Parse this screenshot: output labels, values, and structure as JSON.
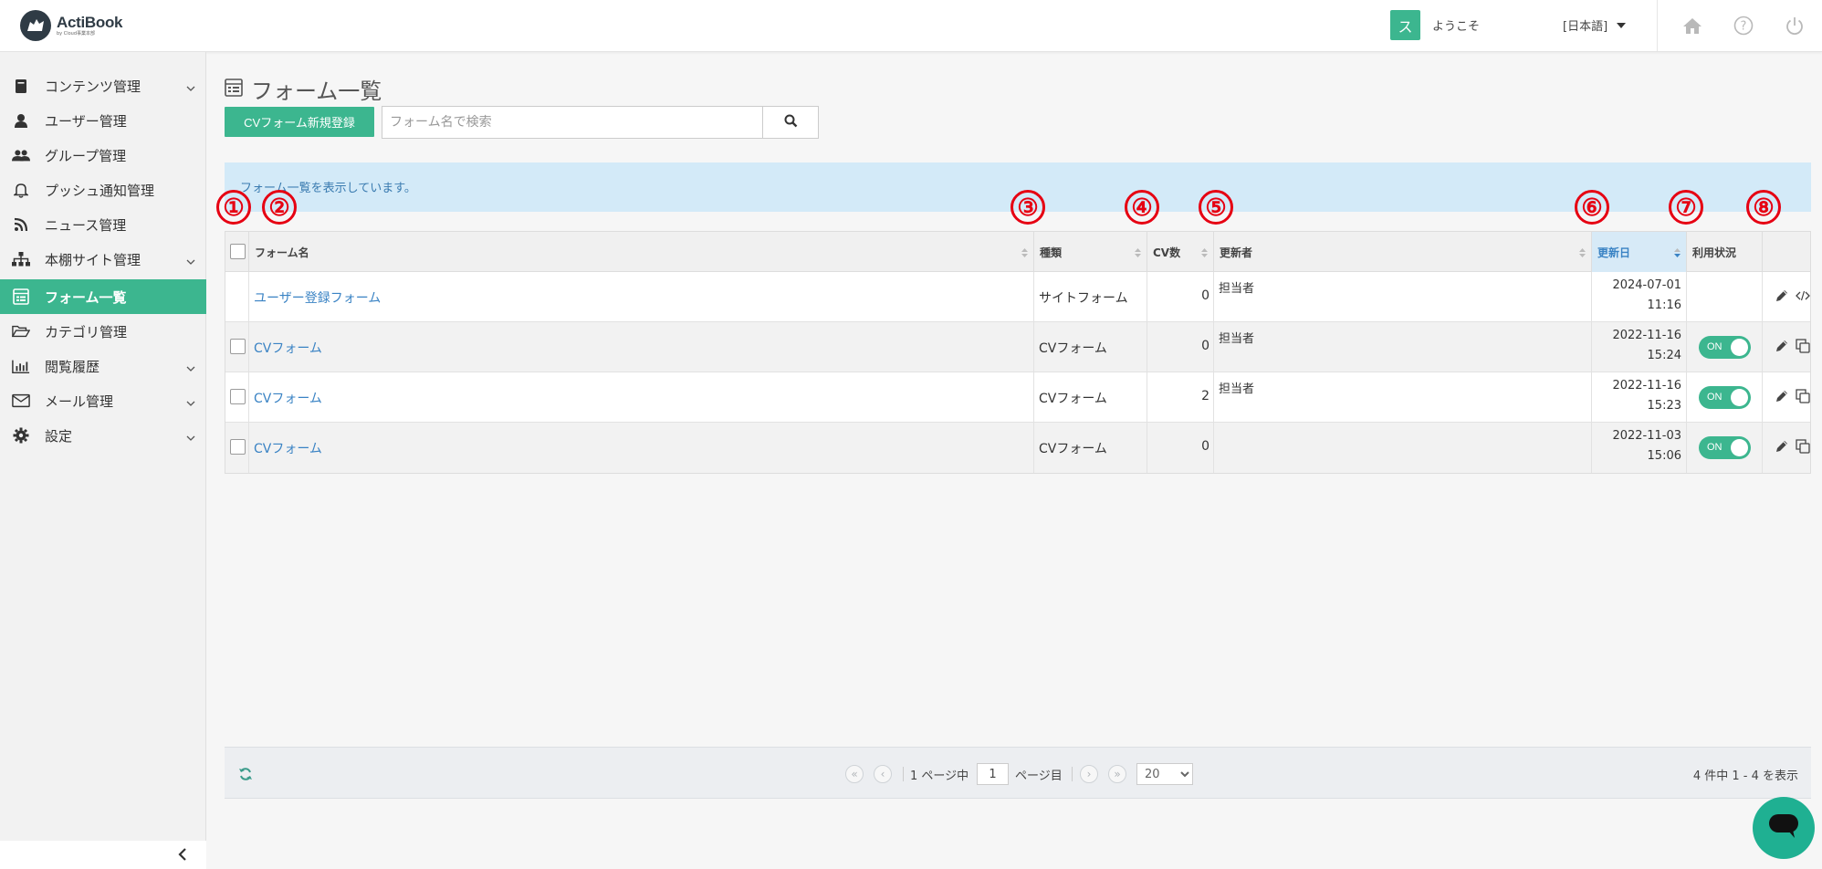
{
  "header": {
    "logo_title": "ActiBook",
    "logo_sub": "by Cloud事業本部",
    "user_initial": "ス",
    "welcome": "ようこそ",
    "language": "[日本語]"
  },
  "sidebar": {
    "items": [
      {
        "label": "コンテンツ管理",
        "icon": "book-icon",
        "has_submenu": true
      },
      {
        "label": "ユーザー管理",
        "icon": "user-icon",
        "has_submenu": false
      },
      {
        "label": "グループ管理",
        "icon": "users-icon",
        "has_submenu": false
      },
      {
        "label": "プッシュ通知管理",
        "icon": "bell-icon",
        "has_submenu": false
      },
      {
        "label": "ニュース管理",
        "icon": "rss-icon",
        "has_submenu": false
      },
      {
        "label": "本棚サイト管理",
        "icon": "sitemap-icon",
        "has_submenu": true
      },
      {
        "label": "フォーム一覧",
        "icon": "form-icon",
        "has_submenu": false,
        "active": true
      },
      {
        "label": "カテゴリ管理",
        "icon": "folder-open-icon",
        "has_submenu": false
      },
      {
        "label": "閲覧履歴",
        "icon": "bar-chart-icon",
        "has_submenu": true
      },
      {
        "label": "メール管理",
        "icon": "envelope-icon",
        "has_submenu": true
      },
      {
        "label": "設定",
        "icon": "gear-icon",
        "has_submenu": true
      }
    ]
  },
  "page": {
    "title": "フォーム一覧",
    "new_button": "CVフォーム新規登録",
    "search_placeholder": "フォーム名で検索",
    "info": "フォーム一覧を表示しています。"
  },
  "annotations": [
    "①",
    "②",
    "③",
    "④",
    "⑤",
    "⑥",
    "⑦",
    "⑧"
  ],
  "table": {
    "columns": [
      "フォーム名",
      "種類",
      "CV数",
      "更新者",
      "更新日",
      "利用状況"
    ],
    "rows": [
      {
        "name": "ユーザー登録フォーム",
        "type": "サイトフォーム",
        "cv": "0",
        "updater": "担当者",
        "date": "2024-07-01",
        "time": "11:16",
        "checkbox": false,
        "toggle": null,
        "second_action": "code-icon"
      },
      {
        "name": "CVフォーム",
        "type": "CVフォーム",
        "cv": "0",
        "updater": "担当者",
        "date": "2022-11-16",
        "time": "15:24",
        "checkbox": true,
        "toggle": "ON",
        "second_action": "copy-icon"
      },
      {
        "name": "CVフォーム",
        "type": "CVフォーム",
        "cv": "2",
        "updater": "担当者",
        "date": "2022-11-16",
        "time": "15:23",
        "checkbox": true,
        "toggle": "ON",
        "second_action": "copy-icon"
      },
      {
        "name": "CVフォーム",
        "type": "CVフォーム",
        "cv": "0",
        "updater": "",
        "date": "2022-11-03",
        "time": "15:06",
        "checkbox": true,
        "toggle": "ON",
        "second_action": "copy-icon"
      }
    ]
  },
  "pager": {
    "page_of_prefix": "1 ページ中",
    "current_page": "1",
    "page_suffix": "ページ目",
    "per_page": "20",
    "summary": "4 件中 1 - 4 を表示"
  },
  "colors": {
    "accent": "#3cb68f",
    "link": "#3a83c4",
    "info_bg": "#d3eaf8",
    "annotation": "#e60012"
  }
}
